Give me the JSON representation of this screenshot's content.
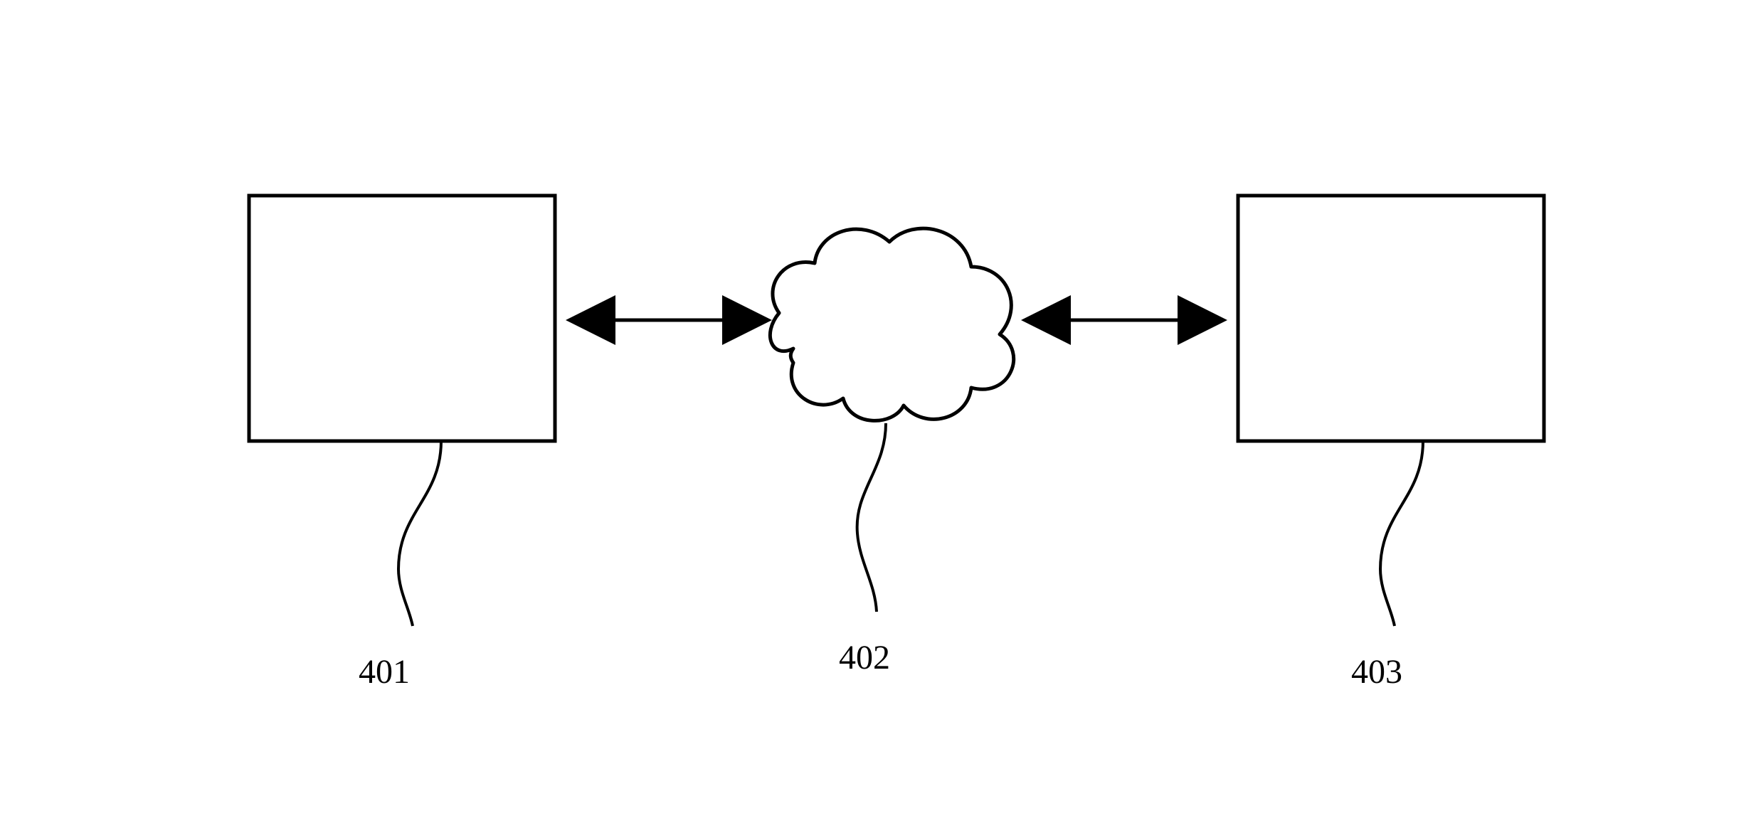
{
  "diagram": {
    "left_box_label": "401",
    "cloud_label": "402",
    "right_box_label": "403"
  },
  "chart_data": {
    "type": "diagram",
    "title": "",
    "nodes": [
      {
        "id": "401",
        "shape": "rectangle",
        "position": "left"
      },
      {
        "id": "402",
        "shape": "cloud",
        "position": "center"
      },
      {
        "id": "403",
        "shape": "rectangle",
        "position": "right"
      }
    ],
    "edges": [
      {
        "from": "401",
        "to": "402",
        "type": "bidirectional"
      },
      {
        "from": "402",
        "to": "403",
        "type": "bidirectional"
      }
    ]
  }
}
